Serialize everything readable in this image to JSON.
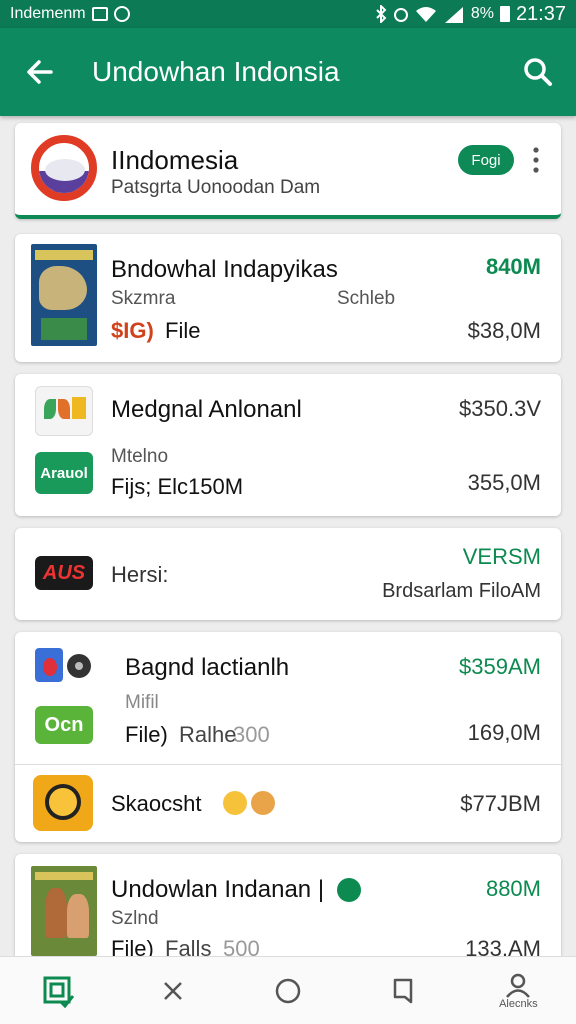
{
  "status_bar": {
    "carrier": "Indemenm",
    "battery": "8%",
    "time": "21:37"
  },
  "app_bar": {
    "title": "Undowhan Indonsia",
    "back_icon": "arrow-back-icon",
    "search_icon": "search-icon"
  },
  "header_card": {
    "title": "IIndomesia",
    "subtitle": "Patsgrta Uonoodan Dam",
    "button": "Fogi",
    "accent": "#0d8a55"
  },
  "items": [
    {
      "title": "Bndowhal Indapyikas",
      "line2_left": "Skzmra",
      "line2_mid": "Schleb",
      "price": "$IG)",
      "line3_left": "File",
      "size_top": "840M",
      "size_bottom": "$38,0M"
    },
    {
      "title": "Medgnal Anlonanl",
      "line2_left": "Mtelno",
      "line3_left": "Fijs; Elc150M",
      "size_top": "$350.3V",
      "size_bottom": "355,0M",
      "logo_text": "Arauol"
    },
    {
      "label": "Hersi:",
      "logo_text": "AUS",
      "size_top": "VERSM",
      "size_bottom": "Brdsarlam FiloAM"
    },
    {
      "title": "Bagnd lactianlh",
      "line2_left": "Mifil",
      "line3_left": "File)",
      "line3_mid": "Ralhe",
      "line3_grey": "300",
      "size_top": "$359AM",
      "size_bottom": "169,0M",
      "logo_text": "Ocn"
    },
    {
      "title": "Skaocsht",
      "size_top": "$77JBM"
    },
    {
      "title": "Undowlan Indanan |",
      "line2_left": "Szlnd",
      "line3_left": "File)",
      "line3_mid": "Falls",
      "line3_grey": "500",
      "size_top": "880M",
      "size_bottom": "133,AM"
    }
  ],
  "bottom_nav": {
    "items": [
      {
        "icon": "library-check-icon"
      },
      {
        "icon": "close-icon"
      },
      {
        "icon": "circle-icon"
      },
      {
        "icon": "bookmark-icon"
      },
      {
        "icon": "profile-icon",
        "label": "Alecnks"
      }
    ]
  }
}
